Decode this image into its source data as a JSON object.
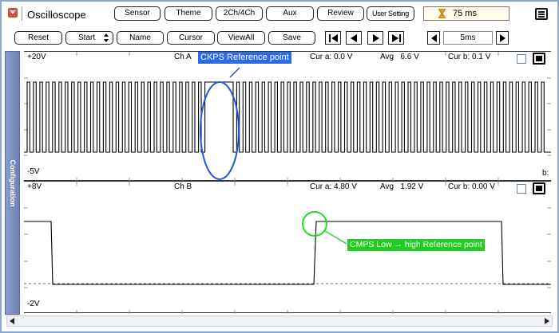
{
  "app": {
    "title": "Oscilloscope",
    "icon": "dropdown-arrow-icon"
  },
  "toolbar": {
    "sensor": "Sensor",
    "theme": "Theme",
    "channels": "2Ch/4Ch",
    "aux": "Aux",
    "review": "Review",
    "user_setting": "User Setting",
    "sample_time": "75 ms"
  },
  "toolbar2": {
    "reset": "Reset",
    "start": "Start",
    "name": "Name",
    "cursor": "Cursor",
    "viewall": "ViewAll",
    "save": "Save",
    "timebase": "5ms"
  },
  "sidebar": {
    "label": "Configuration"
  },
  "channel_a": {
    "name": "Ch A",
    "top_scale": "+20V",
    "bottom_scale": "-5V",
    "cur_a": "Cur a: 0.0 V",
    "avg": "Avg   6.6 V",
    "cur_b": "Cur b: 0.1 V",
    "marker_b": "b:",
    "annotation": "CKPS Reference point"
  },
  "channel_b": {
    "name": "Ch B",
    "top_scale": "+8V",
    "bottom_scale": "-2V",
    "cur_a": "Cur a: 4.80 V",
    "avg": "Avg   1.92 V",
    "cur_b": "Cur b: 0.00 V",
    "annotation": "CMPS Low → high Reference point"
  },
  "colors": {
    "frame": "#8aa8cc",
    "sidebar": "#7a8dc0",
    "callout_blue": "#2b6bea",
    "callout_green": "#22cc22",
    "highlight_blue": "#2255dd",
    "highlight_green": "#22dd22"
  }
}
